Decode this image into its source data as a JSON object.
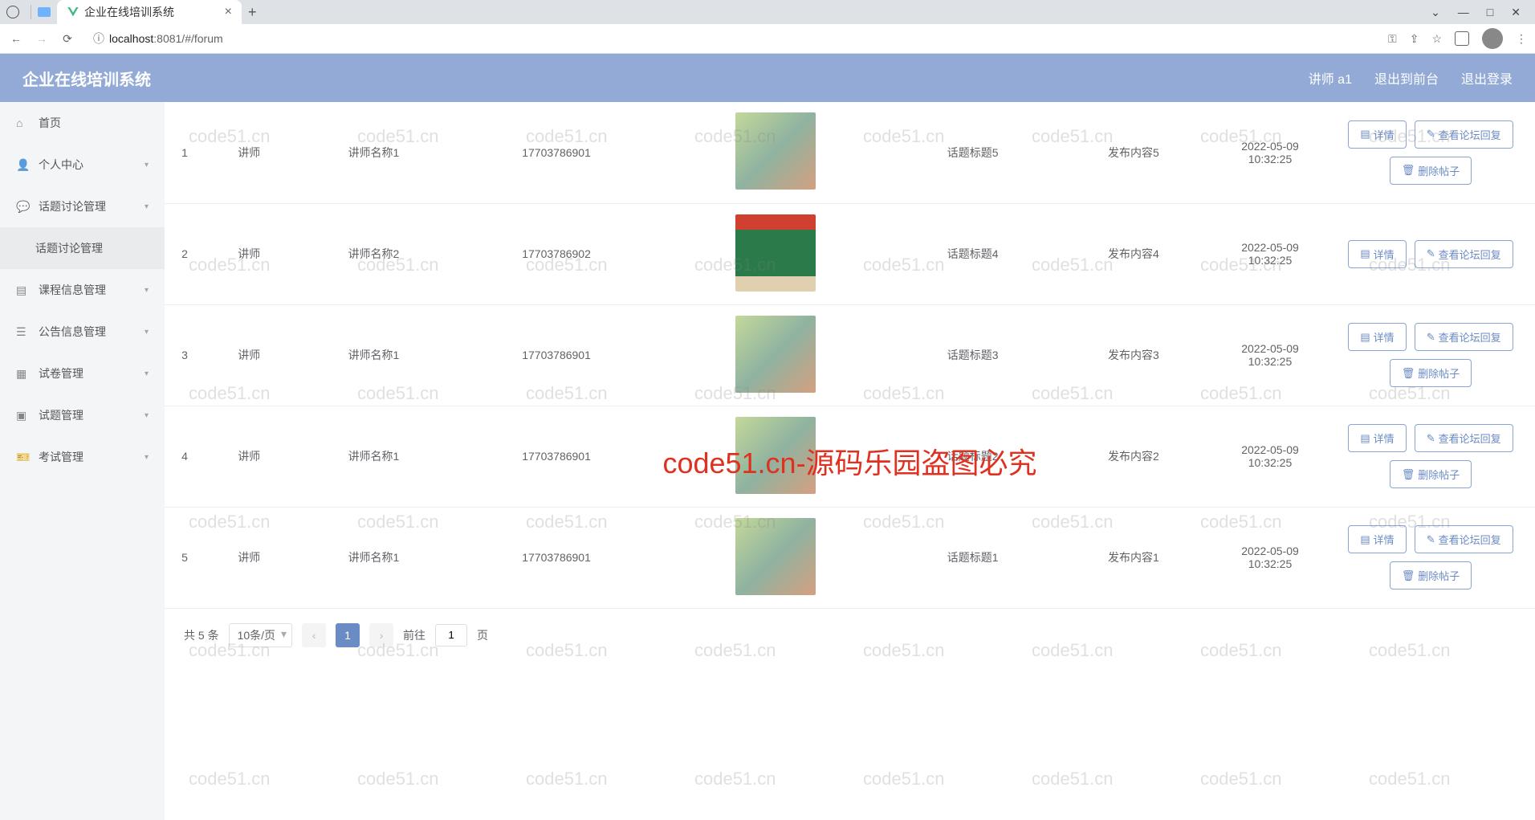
{
  "browser": {
    "tab_title": "企业在线培训系统",
    "url_scheme": "localhost",
    "url_rest": ":8081/#/forum",
    "window_controls": {
      "min": "—",
      "max": "□",
      "close": "✕",
      "caret": "⌄"
    }
  },
  "header": {
    "app_title": "企业在线培训系统",
    "user_label": "讲师 a1",
    "logout_front": "退出到前台",
    "logout": "退出登录"
  },
  "sidebar": [
    {
      "label": "首页",
      "icon": "home"
    },
    {
      "label": "个人中心",
      "icon": "user"
    },
    {
      "label": "话题讨论管理",
      "icon": "chat"
    },
    {
      "label": "话题讨论管理",
      "icon": "",
      "sub": true
    },
    {
      "label": "课程信息管理",
      "icon": "book"
    },
    {
      "label": "公告信息管理",
      "icon": "list"
    },
    {
      "label": "试卷管理",
      "icon": "doc"
    },
    {
      "label": "试题管理",
      "icon": "grid"
    },
    {
      "label": "考试管理",
      "icon": "ticket"
    }
  ],
  "table": {
    "rows": [
      {
        "seq": "1",
        "role": "讲师",
        "name": "讲师名称1",
        "phone": "17703786901",
        "img": "classroom",
        "title": "话题标题5",
        "content": "发布内容5",
        "time": "2022-05-09 10:32:25",
        "can_delete": true
      },
      {
        "seq": "2",
        "role": "讲师",
        "name": "讲师名称2",
        "phone": "17703786902",
        "img": "green",
        "title": "话题标题4",
        "content": "发布内容4",
        "time": "2022-05-09 10:32:25",
        "can_delete": false
      },
      {
        "seq": "3",
        "role": "讲师",
        "name": "讲师名称1",
        "phone": "17703786901",
        "img": "classroom",
        "title": "话题标题3",
        "content": "发布内容3",
        "time": "2022-05-09 10:32:25",
        "can_delete": true
      },
      {
        "seq": "4",
        "role": "讲师",
        "name": "讲师名称1",
        "phone": "17703786901",
        "img": "classroom",
        "title": "话题标题2",
        "content": "发布内容2",
        "time": "2022-05-09 10:32:25",
        "can_delete": true
      },
      {
        "seq": "5",
        "role": "讲师",
        "name": "讲师名称1",
        "phone": "17703786901",
        "img": "classroom",
        "title": "话题标题1",
        "content": "发布内容1",
        "time": "2022-05-09 10:32:25",
        "can_delete": true
      }
    ],
    "actions": {
      "detail": "详情",
      "view_reply": "查看论坛回复",
      "delete": "删除帖子"
    }
  },
  "pagination": {
    "total": "共 5 条",
    "per_page": "10条/页",
    "current": "1",
    "goto_pre": "前往",
    "goto_post": "页"
  },
  "watermark": {
    "text": "code51.cn",
    "center": "code51.cn-源码乐园盗图必究"
  }
}
